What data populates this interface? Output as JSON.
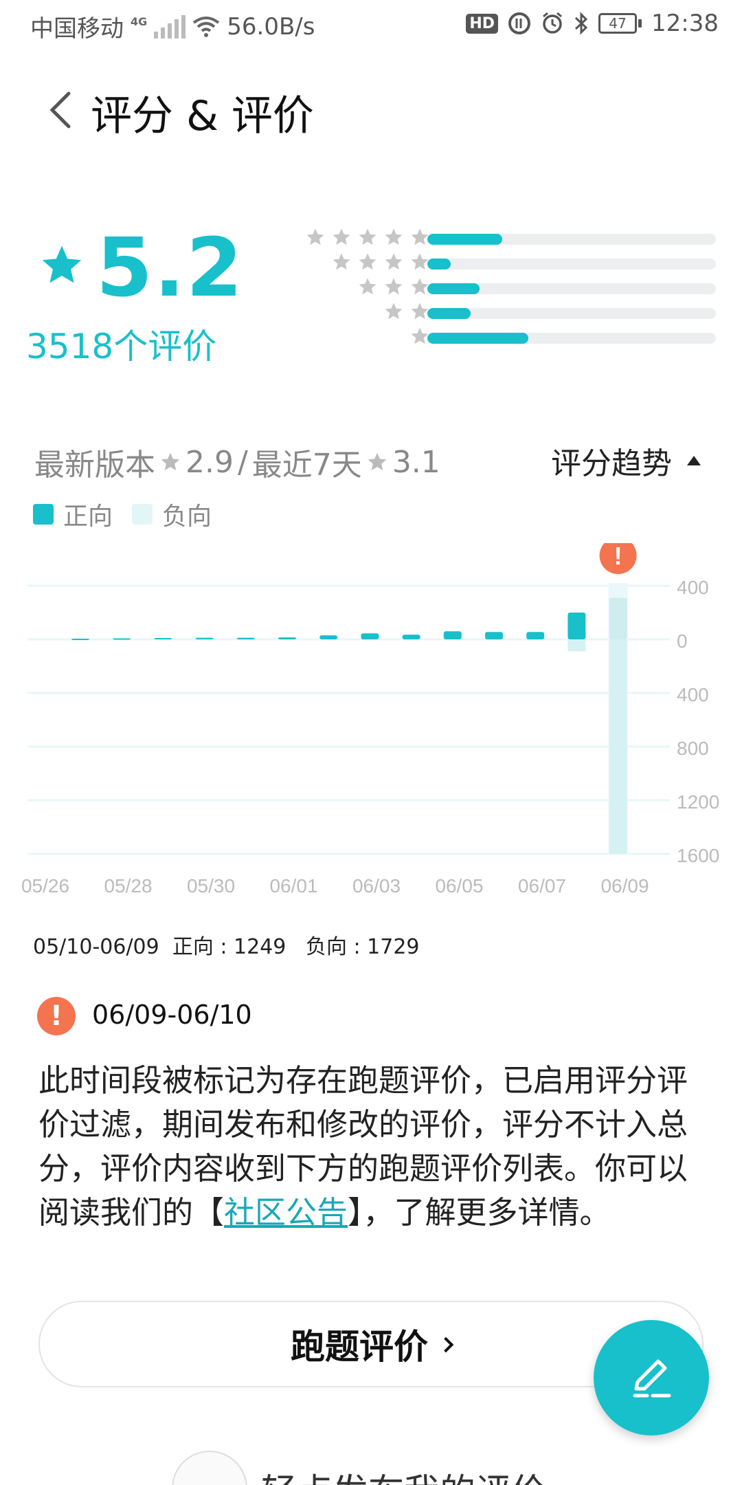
{
  "status_bar": {
    "carrier": "中国移动",
    "network": "4G",
    "speed": "56.0B/s",
    "hd": "HD",
    "battery": "47",
    "time": "12:38"
  },
  "header": {
    "title": "评分 & 评价"
  },
  "rating": {
    "score": "5.2",
    "count_label": "3518个评价",
    "distribution": [
      {
        "stars": 5,
        "fraction": 0.26
      },
      {
        "stars": 4,
        "fraction": 0.08
      },
      {
        "stars": 3,
        "fraction": 0.18
      },
      {
        "stars": 2,
        "fraction": 0.15
      },
      {
        "stars": 1,
        "fraction": 0.35
      }
    ]
  },
  "version_line": {
    "latest_label": "最新版本",
    "latest_score": "2.9",
    "separator": "/",
    "recent_label": "最近7天",
    "recent_score": "3.1",
    "trend_label": "评分趋势"
  },
  "legend": {
    "positive": "正向",
    "negative": "负向"
  },
  "colors": {
    "accent": "#17c0cb",
    "negative": "#d6f1f3",
    "warning": "#f3744f"
  },
  "chart_data": {
    "type": "bar",
    "x_labels": [
      "05/26",
      "05/28",
      "05/30",
      "06/01",
      "06/03",
      "06/05",
      "06/07",
      "06/09"
    ],
    "y_tick_labels": [
      "400",
      "0",
      "400",
      "800",
      "1200",
      "1600"
    ],
    "ylim": [
      -1600,
      400
    ],
    "series": [
      {
        "name": "正向",
        "values": [
          5,
          8,
          10,
          12,
          12,
          15,
          30,
          45,
          35,
          60,
          55,
          55,
          200,
          310
        ]
      },
      {
        "name": "负向",
        "values": [
          0,
          0,
          0,
          0,
          0,
          0,
          0,
          0,
          0,
          0,
          0,
          0,
          -90,
          -1600
        ]
      }
    ],
    "flagged_index": 13
  },
  "summary": {
    "range": "05/10-06/09",
    "positive_label": "正向 : 1249",
    "negative_label": "负向 : 1729"
  },
  "notice": {
    "date_range": "06/09-06/10",
    "body_before": "此时间段被标记为存在跑题评价，已启用评分评价过滤，期间发布和修改的评价，评分不计入总分，评价内容收到下方的跑题评价列表。你可以阅读我们的【",
    "link_text": "社区公告",
    "body_after": "】，了解更多详情。"
  },
  "off_topic_button": "跑题评价",
  "bottom": {
    "partial_text": "轻点发布我的评价"
  }
}
